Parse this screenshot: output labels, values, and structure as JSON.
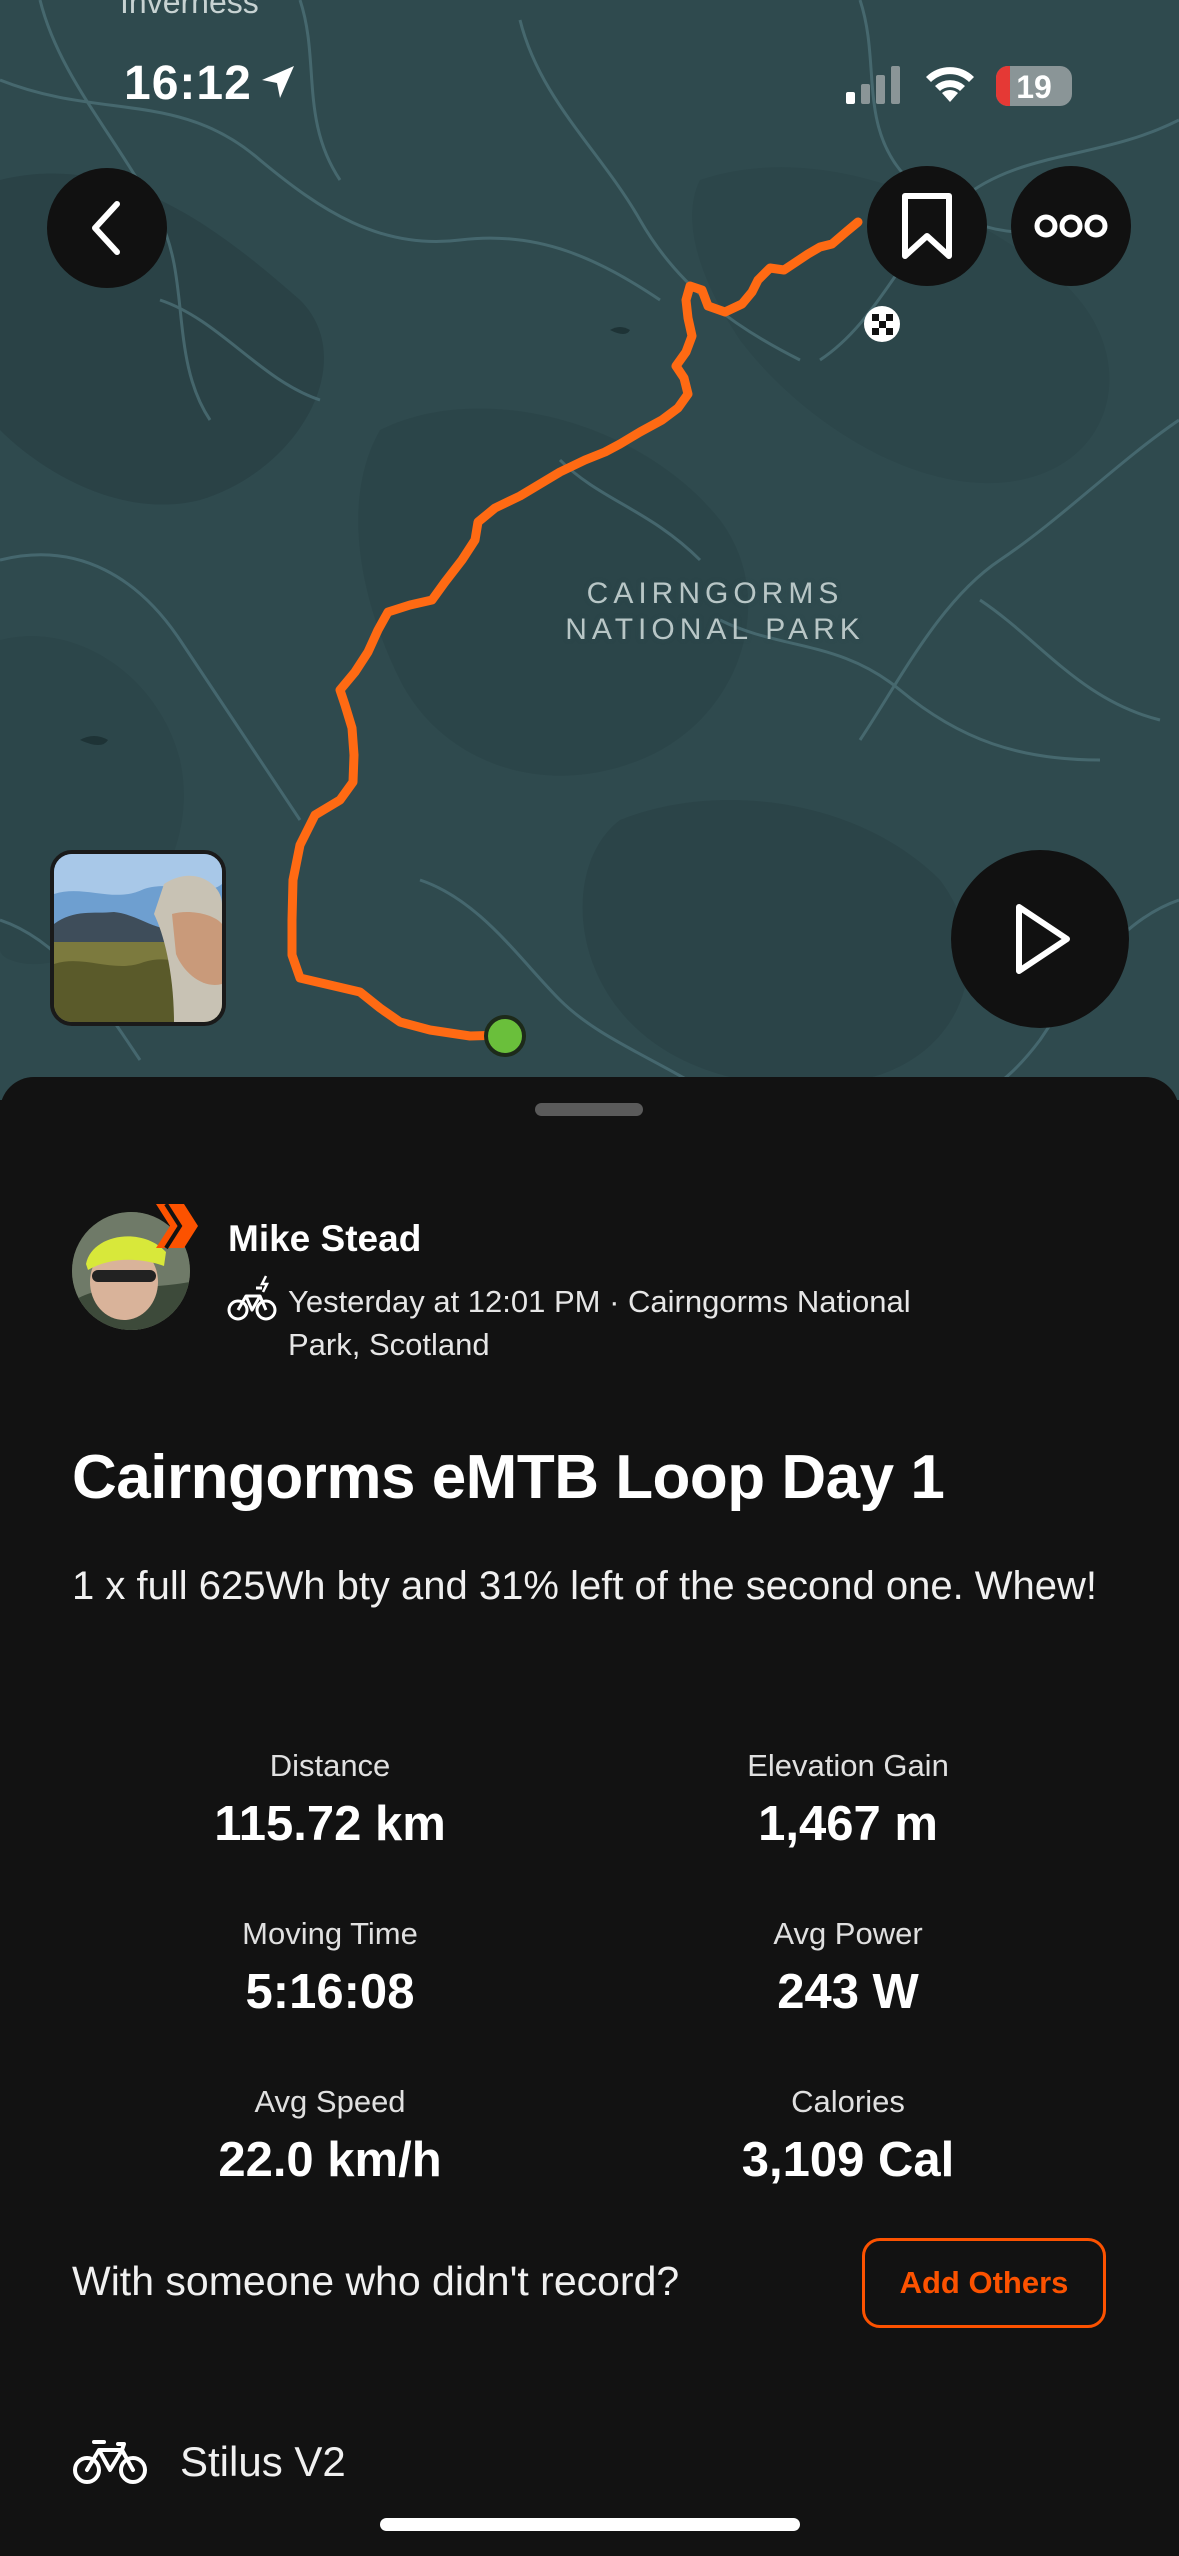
{
  "status_bar": {
    "time": "16:12",
    "battery_level": "19",
    "battery_fraction": 0.19,
    "icons": [
      "location-arrow-icon",
      "signal-icon",
      "wifi-icon",
      "battery-icon"
    ]
  },
  "map": {
    "top_place_label": "Inverness",
    "park_label": "CAIRNGORMS NATIONAL PARK",
    "route_color": "#fc5200",
    "start_marker_color": "#6abf3b",
    "icons": [
      "back-chevron-icon",
      "bookmark-icon",
      "more-icon",
      "play-icon",
      "finish-flag-icon"
    ]
  },
  "activity": {
    "athlete_name": "Mike Stead",
    "sport_icon": "ebike-icon",
    "meta": "Yesterday at 12:01 PM · Cairngorms National Park, Scotland",
    "title": "Cairngorms eMTB Loop Day 1",
    "description": "1 x full 625Wh bty and 31% left of the second one. Whew!",
    "stats": [
      {
        "label": "Distance",
        "value": "115.72 km"
      },
      {
        "label": "Elevation Gain",
        "value": "1,467 m"
      },
      {
        "label": "Moving Time",
        "value": "5:16:08"
      },
      {
        "label": "Avg Power",
        "value": "243 W"
      },
      {
        "label": "Avg Speed",
        "value": "22.0 km/h"
      },
      {
        "label": "Calories",
        "value": "3,109 Cal"
      }
    ],
    "with_others_prompt": "With someone who didn't record?",
    "add_others_label": "Add Others",
    "gear_name": "Stilus V2",
    "accent_color": "#fc5200"
  }
}
